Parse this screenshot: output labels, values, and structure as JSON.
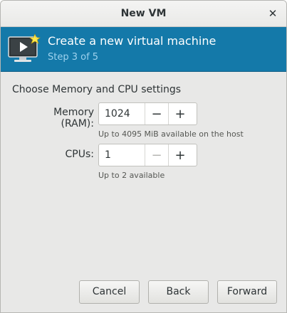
{
  "window": {
    "title": "New VM"
  },
  "banner": {
    "title": "Create a new virtual machine",
    "step": "Step 3 of 5"
  },
  "section": {
    "heading": "Choose Memory and CPU settings"
  },
  "memory": {
    "label": "Memory (RAM):",
    "value": "1024",
    "hint": "Up to 4095 MiB available on the host"
  },
  "cpus": {
    "label": "CPUs:",
    "value": "1",
    "hint": "Up to 2 available"
  },
  "buttons": {
    "cancel": "Cancel",
    "back": "Back",
    "forward": "Forward"
  },
  "icons": {
    "close": "close-icon",
    "minus": "minus-icon",
    "plus": "plus-icon",
    "vm": "vm-monitor-icon"
  },
  "colors": {
    "banner": "#1479a9",
    "step_text": "#9ed2ee"
  }
}
